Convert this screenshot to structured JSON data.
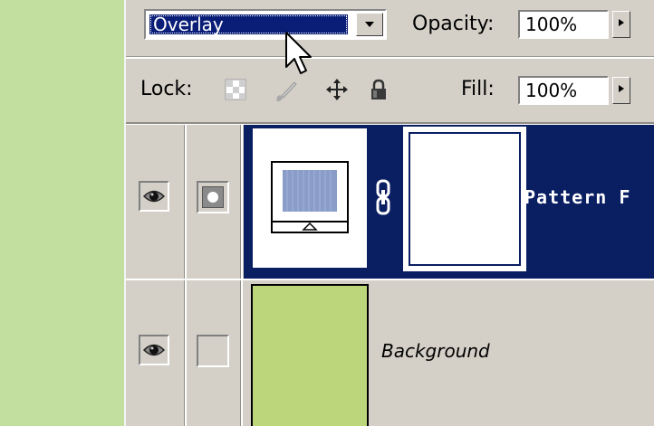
{
  "options_bar": {
    "blend_mode": "Overlay",
    "opacity_label": "Opacity:",
    "opacity_value": "100%",
    "lock_label": "Lock:",
    "fill_label": "Fill:",
    "fill_value": "100%"
  },
  "icons": {
    "blend_dropdown": "chevron-down-icon",
    "opacity_stepper": "triangle-right-icon",
    "fill_stepper": "triangle-right-icon",
    "lock_transparent": "checkerboard-icon",
    "lock_image": "brush-icon",
    "lock_position": "move-icon",
    "lock_all": "padlock-icon",
    "visibility": "eye-icon",
    "link": "chain-link-icon",
    "cursor": "mouse-pointer-icon"
  },
  "layers": [
    {
      "name": "Pattern F",
      "selected": true,
      "visible": true,
      "thumbnail": "pattern-fill-icon",
      "has_mask": true
    },
    {
      "name": "Background",
      "selected": false,
      "visible": true,
      "thumbnail_color": "#bcd67c",
      "italic": true
    }
  ],
  "colors": {
    "selection": "#0a1e62",
    "panel": "#d4d0c8",
    "canvas": "#c3df9f"
  }
}
